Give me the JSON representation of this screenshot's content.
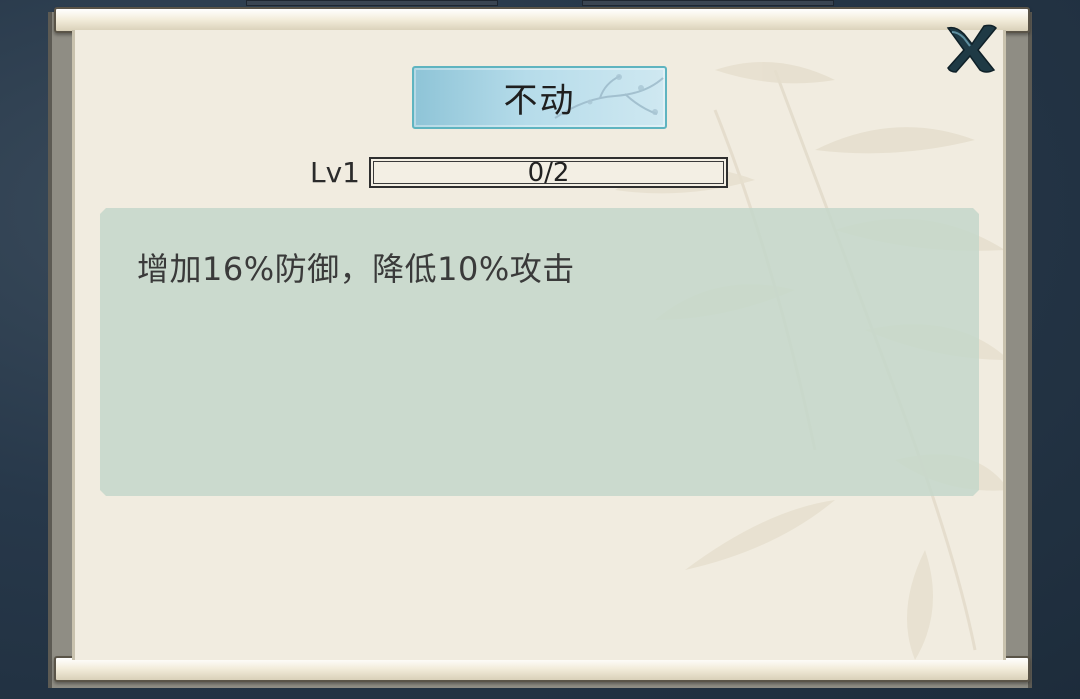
{
  "dialog": {
    "skill_name": "不动",
    "level_label": "Lv1",
    "progress": {
      "text": "0/2",
      "current": 0,
      "max": 2
    },
    "description": "增加16%防御，降低10%攻击"
  },
  "icons": {
    "close": "close-icon"
  },
  "colors": {
    "title_button": "#b6dcea",
    "title_border": "#5fb4c0",
    "description_panel": "#c4d7ca",
    "paper": "#f1ece0",
    "close_icon": "#1f3a45"
  }
}
